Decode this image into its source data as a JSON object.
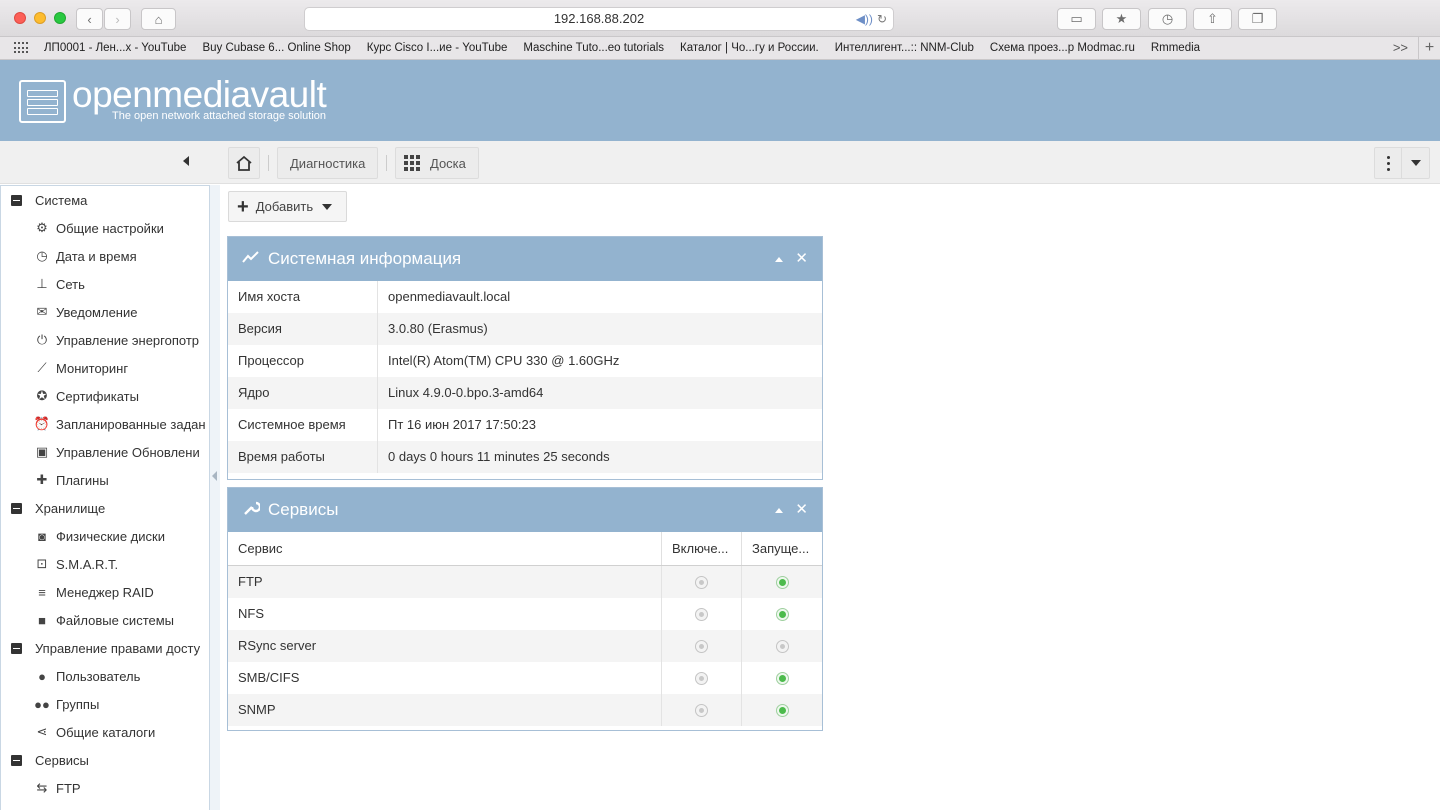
{
  "browser": {
    "url": "192.168.88.202",
    "bookmarks": [
      "ЛП0001 - Лен...x - YouTube",
      "Buy Cubase 6... Online Shop",
      "Курс Cisco I...ие - YouTube",
      "Maschine Tuto...eo tutorials",
      "Каталог | Чо...гу и России.",
      "Интеллигент...:: NNM-Club",
      "Схема проез...р Modmac.ru",
      "Rmmedia"
    ],
    "more": ">>",
    "new_tab": "+"
  },
  "header": {
    "title": "openmediavault",
    "subtitle": "The open network attached storage solution"
  },
  "breadcrumb": {
    "diagnostics": "Диагностика",
    "dashboard": "Доска"
  },
  "sidebar": {
    "groups": [
      {
        "label": "Система",
        "items": [
          {
            "label": "Общие настройки",
            "icon": "gears-icon"
          },
          {
            "label": "Дата и время",
            "icon": "clock-icon"
          },
          {
            "label": "Сеть",
            "icon": "network-icon"
          },
          {
            "label": "Уведомление",
            "icon": "envelope-icon"
          },
          {
            "label": "Управление энергопотр",
            "icon": "power-icon"
          },
          {
            "label": "Мониторинг",
            "icon": "chart-line-icon"
          },
          {
            "label": "Сертификаты",
            "icon": "certificate-icon"
          },
          {
            "label": "Запланированные задан",
            "icon": "alarm-clock-icon"
          },
          {
            "label": "Управление Обновлени",
            "icon": "package-icon"
          },
          {
            "label": "Плагины",
            "icon": "puzzle-icon"
          }
        ]
      },
      {
        "label": "Хранилище",
        "items": [
          {
            "label": "Физические диски",
            "icon": "hdd-icon"
          },
          {
            "label": "S.M.A.R.T.",
            "icon": "smart-icon"
          },
          {
            "label": "Менеджер RAID",
            "icon": "database-icon"
          },
          {
            "label": "Файловые системы",
            "icon": "folder-icon"
          }
        ]
      },
      {
        "label": "Управление правами досту",
        "items": [
          {
            "label": "Пользователь",
            "icon": "user-icon"
          },
          {
            "label": "Группы",
            "icon": "users-icon"
          },
          {
            "label": "Общие каталоги",
            "icon": "share-icon"
          }
        ]
      },
      {
        "label": "Сервисы",
        "items": [
          {
            "label": "FTP",
            "icon": "ftp-icon"
          }
        ]
      }
    ]
  },
  "toolbar": {
    "add_label": "Добавить"
  },
  "sysinfo": {
    "title": "Системная информация",
    "rows": [
      {
        "key": "Имя хоста",
        "value": "openmediavault.local"
      },
      {
        "key": "Версия",
        "value": "3.0.80 (Erasmus)"
      },
      {
        "key": "Процессор",
        "value": "Intel(R) Atom(TM) CPU 330 @ 1.60GHz"
      },
      {
        "key": "Ядро",
        "value": "Linux 4.9.0-0.bpo.3-amd64"
      },
      {
        "key": "Системное время",
        "value": "Пт 16 июн 2017 17:50:23"
      },
      {
        "key": "Время работы",
        "value": "0 days 0 hours 11 minutes 25 seconds"
      }
    ]
  },
  "services": {
    "title": "Сервисы",
    "columns": [
      "Сервис",
      "Включе...",
      "Запуще..."
    ],
    "rows": [
      {
        "name": "FTP",
        "enabled": false,
        "running": true
      },
      {
        "name": "NFS",
        "enabled": false,
        "running": true
      },
      {
        "name": "RSync server",
        "enabled": false,
        "running": false
      },
      {
        "name": "SMB/CIFS",
        "enabled": false,
        "running": true
      },
      {
        "name": "SNMP",
        "enabled": false,
        "running": true
      }
    ]
  },
  "colors": {
    "header_bg": "#93b3cf",
    "status_on": "#4cbb4c",
    "status_off": "#c8c8c8"
  }
}
